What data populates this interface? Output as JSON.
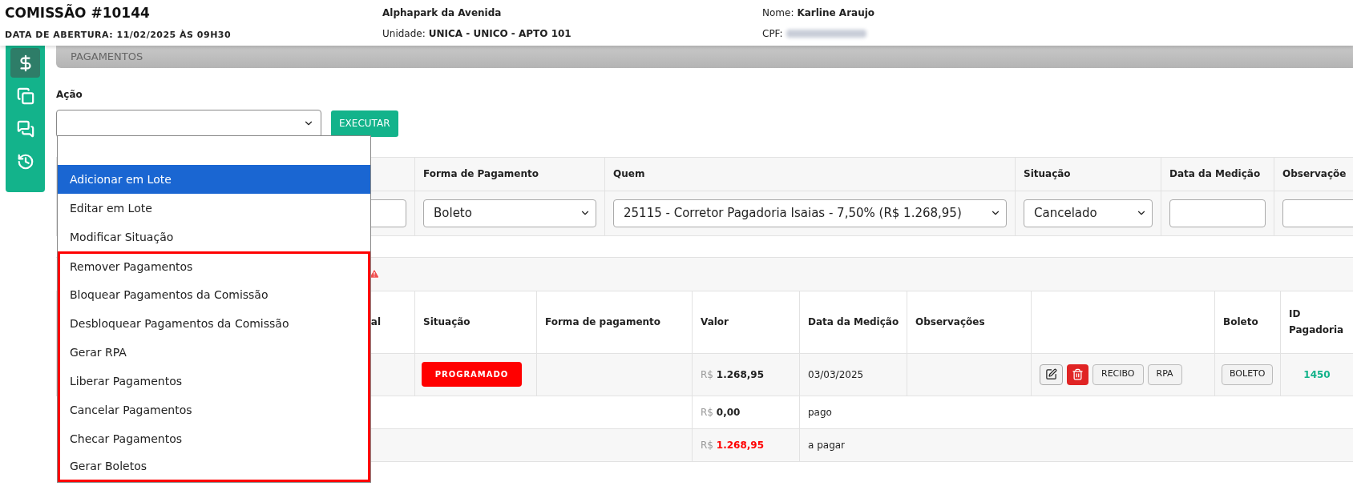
{
  "header": {
    "title": "COMISSÃO #10144",
    "opened": "DATA DE ABERTURA: 11/02/2025 ÀS 09H30",
    "development": "Alphapark da Avenida",
    "unit_label": "Unidade:",
    "unit": "UNICA - UNICO - APTO 101",
    "name_label": "Nome:",
    "name": "Karline Araujo",
    "cpf_label": "CPF:"
  },
  "sidebar": {
    "items": [
      {
        "kind": "dollar",
        "selected": true
      },
      {
        "kind": "copy",
        "selected": false
      },
      {
        "kind": "chat",
        "selected": false
      },
      {
        "kind": "history",
        "selected": false
      }
    ]
  },
  "panel": {
    "title": "PAGAMENTOS"
  },
  "action": {
    "label": "Ação",
    "button": "EXECUTAR",
    "expanded": true,
    "options": [
      {
        "kind": "blank",
        "selected": false,
        "boxed": false
      },
      {
        "kind": "option",
        "label": "Adicionar em Lote",
        "selected": true,
        "boxed": false
      },
      {
        "kind": "option",
        "label": "Editar em Lote",
        "selected": false,
        "boxed": false
      },
      {
        "kind": "option",
        "label": "Modificar Situação",
        "selected": false,
        "boxed": false
      },
      {
        "kind": "option",
        "label": "Remover Pagamentos",
        "selected": false,
        "boxed": true
      },
      {
        "kind": "option",
        "label": "Bloquear Pagamentos da Comissão",
        "selected": false,
        "boxed": true
      },
      {
        "kind": "option",
        "label": "Desbloquear Pagamentos da Comissão",
        "selected": false,
        "boxed": true
      },
      {
        "kind": "option",
        "label": "Gerar RPA",
        "selected": false,
        "boxed": true
      },
      {
        "kind": "option",
        "label": "Liberar Pagamentos",
        "selected": false,
        "boxed": true
      },
      {
        "kind": "option",
        "label": "Cancelar Pagamentos",
        "selected": false,
        "boxed": true
      },
      {
        "kind": "option",
        "label": "Checar Pagamentos",
        "selected": false,
        "boxed": true
      },
      {
        "kind": "option",
        "label": "Gerar Boletos",
        "selected": false,
        "boxed": true
      }
    ]
  },
  "form_table": {
    "columns": [
      {
        "kind": "blank"
      },
      {
        "label": "Forma de Pagamento"
      },
      {
        "label": "Quem"
      },
      {
        "label": "Situação"
      },
      {
        "label": "Data da Medição"
      },
      {
        "label": "Observaçõe"
      }
    ],
    "fields": [
      {
        "kind": "input"
      },
      {
        "kind": "select",
        "value": "Boleto"
      },
      {
        "kind": "select",
        "value": "25115 - Corretor Pagadoria Isaias - 7,50% (R$ 1.268,95)"
      },
      {
        "kind": "select",
        "value": "Cancelado"
      },
      {
        "kind": "input"
      },
      {
        "kind": "input"
      }
    ]
  },
  "warning": true,
  "payments_table": {
    "columns": [
      {
        "label": "al"
      },
      {
        "label": "Situação"
      },
      {
        "label": "Forma de pagamento"
      },
      {
        "label": "Valor"
      },
      {
        "label": "Data da Medição"
      },
      {
        "label": "Observações"
      },
      {
        "kind": "blank"
      },
      {
        "label": "Boleto"
      },
      {
        "label": "ID Pagadoria"
      }
    ],
    "row": {
      "status": "PROGRAMADO",
      "currency": "R$",
      "amount": "1.268,95",
      "date": "03/03/2025",
      "actions": [
        "RECIBO",
        "RPA"
      ],
      "boleto": "BOLETO",
      "id": "1450"
    },
    "totals": [
      {
        "currency": "R$",
        "amount": "0,00",
        "label": "pago",
        "alert": false
      },
      {
        "currency": "R$",
        "amount": "1.268,95",
        "label": "a pagar",
        "alert": true
      }
    ]
  }
}
